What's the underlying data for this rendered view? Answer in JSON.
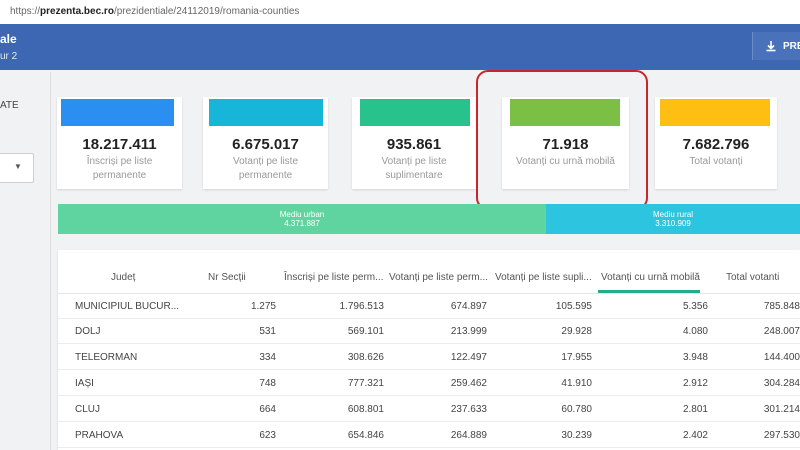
{
  "browser": {
    "url_prefix": "https://",
    "url_host": "prezenta.bec.ro",
    "url_path": "/prezidentiale/24112019/romania-counties"
  },
  "header": {
    "title_fragment": "ale",
    "subtitle_fragment": "ur 2",
    "button_label": "PRE"
  },
  "sidebar": {
    "label_fragment": "ATE"
  },
  "cards": [
    {
      "value": "18.217.411",
      "label": "Înscriși pe liste permanente",
      "color": "#2b8ef1"
    },
    {
      "value": "6.675.017",
      "label": "Votanți pe liste permanente",
      "color": "#17b6d9"
    },
    {
      "value": "935.861",
      "label": "Votanți pe liste suplimentare",
      "color": "#28c28c"
    },
    {
      "value": "71.918",
      "label": "Votanți cu urnă mobilă",
      "color": "#7bbf44"
    },
    {
      "value": "7.682.796",
      "label": "Total votanți",
      "color": "#ffbe12"
    }
  ],
  "bars": {
    "urban": {
      "label": "Mediu urban",
      "value": "4.371.887",
      "color": "#5fd3a0"
    },
    "rural": {
      "label": "Mediu rural",
      "value": "3.310.909",
      "color": "#2cc4de"
    }
  },
  "table": {
    "columns": [
      "Județ",
      "Nr Secții",
      "Înscriși pe liste perm...",
      "Votanți pe liste perm...",
      "Votanți pe liste supli...",
      "Votanți cu urnă mobilă",
      "Total votanti"
    ],
    "rows": [
      [
        "MUNICIPIUL BUCUR...",
        "1.275",
        "1.796.513",
        "674.897",
        "105.595",
        "5.356",
        "785.848"
      ],
      [
        "DOLJ",
        "531",
        "569.101",
        "213.999",
        "29.928",
        "4.080",
        "248.007"
      ],
      [
        "TELEORMAN",
        "334",
        "308.626",
        "122.497",
        "17.955",
        "3.948",
        "144.400"
      ],
      [
        "IAȘI",
        "748",
        "777.321",
        "259.462",
        "41.910",
        "2.912",
        "304.284"
      ],
      [
        "CLUJ",
        "664",
        "608.801",
        "237.633",
        "60.780",
        "2.801",
        "301.214"
      ],
      [
        "PRAHOVA",
        "623",
        "654.846",
        "264.889",
        "30.239",
        "2.402",
        "297.530"
      ]
    ]
  }
}
